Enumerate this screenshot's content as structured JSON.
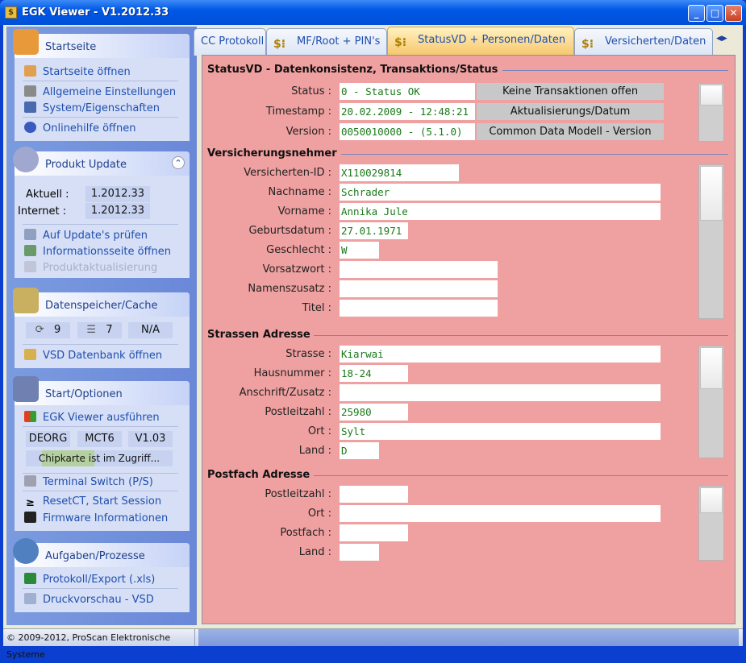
{
  "window": {
    "title": "EGK Viewer - V1.2012.33",
    "min": "_",
    "max": "□",
    "close": "✕"
  },
  "sidebar": {
    "startseite": {
      "title": "Startseite",
      "items": [
        "Startseite öffnen",
        "Allgemeine Einstellungen",
        "System/Eigenschaften",
        "Onlinehilfe öffnen"
      ]
    },
    "update": {
      "title": "Produkt Update",
      "collapse": "⌃",
      "aktuell_label": "Aktuell :",
      "aktuell": "1.2012.33",
      "internet_label": "Internet :",
      "internet": "1.2012.33",
      "items": [
        "Auf Update's prüfen",
        "Informationsseite öffnen",
        "Produktaktualisierung"
      ]
    },
    "cache": {
      "title": "Datenspeicher/Cache",
      "c1": "9",
      "c2": "7",
      "c3": "N/A",
      "items": [
        "VSD Datenbank öffnen"
      ]
    },
    "start": {
      "title": "Start/Optionen",
      "run": "EGK Viewer ausführen",
      "c1": "DEORG",
      "c2": "MCT6",
      "c3": "V1.03",
      "status": "Chipkarte ist im Zugriff...",
      "items": [
        "Terminal Switch (P/S)",
        "ResetCT, Start Session",
        "Firmware Informationen"
      ]
    },
    "aufgaben": {
      "title": "Aufgaben/Prozesse",
      "items": [
        "Protokoll/Export (.xls)",
        "Druckvorschau - VSD"
      ]
    }
  },
  "tabs": [
    "CC Protokoll",
    "MF/Root + PIN's",
    "StatusVD + Personen/Daten",
    "Versicherten/Daten"
  ],
  "tab_scroll": {
    "left": "◀",
    "right": "▶"
  },
  "status": {
    "header": "StatusVD - Datenkonsistenz, Transaktions/Status",
    "rows": [
      {
        "label": "Status :",
        "value": "0 - Status OK",
        "info": "Keine Transaktionen offen"
      },
      {
        "label": "Timestamp :",
        "value": "20.02.2009 - 12:48:21",
        "info": "Aktualisierungs/Datum"
      },
      {
        "label": "Version :",
        "value": "0050010000 - (5.1.0)",
        "info": "Common Data Modell - Version"
      }
    ]
  },
  "versicherungsnehmer": {
    "header": "Versicherungsnehmer",
    "rows": [
      {
        "label": "Versicherten-ID :",
        "value": "X110029814"
      },
      {
        "label": "Nachname :",
        "value": "Schrader"
      },
      {
        "label": "Vorname :",
        "value": "Annika Jule"
      },
      {
        "label": "Geburtsdatum :",
        "value": "27.01.1971"
      },
      {
        "label": "Geschlecht :",
        "value": "W"
      },
      {
        "label": "Vorsatzwort :",
        "value": ""
      },
      {
        "label": "Namenszusatz :",
        "value": ""
      },
      {
        "label": "Titel :",
        "value": ""
      }
    ]
  },
  "strasse": {
    "header": "Strassen Adresse",
    "rows": [
      {
        "label": "Strasse :",
        "value": "Kiarwai"
      },
      {
        "label": "Hausnummer :",
        "value": "18-24"
      },
      {
        "label": "Anschrift/Zusatz :",
        "value": ""
      },
      {
        "label": "Postleitzahl :",
        "value": "25980"
      },
      {
        "label": "Ort :",
        "value": "Sylt"
      },
      {
        "label": "Land :",
        "value": "D"
      }
    ]
  },
  "postfach": {
    "header": "Postfach Adresse",
    "rows": [
      {
        "label": "Postleitzahl :",
        "value": ""
      },
      {
        "label": "Ort :",
        "value": ""
      },
      {
        "label": "Postfach :",
        "value": ""
      },
      {
        "label": "Land :",
        "value": ""
      }
    ]
  },
  "statusbar": {
    "copyright": "© 2009-2012, ProScan Elektronische Systeme"
  }
}
